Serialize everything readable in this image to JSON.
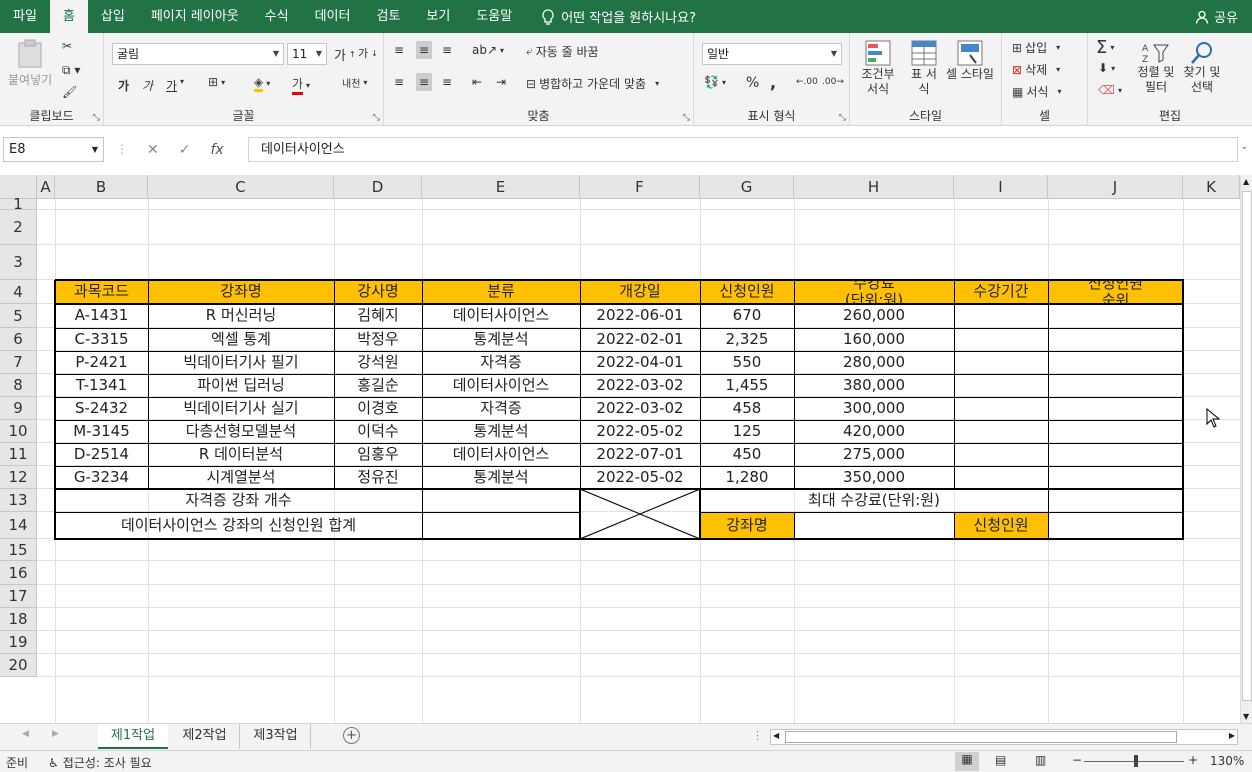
{
  "menu": {
    "tabs": [
      "파일",
      "홈",
      "삽입",
      "페이지 레이아웃",
      "수식",
      "데이터",
      "검토",
      "보기",
      "도움말"
    ],
    "active": "홈",
    "tell_me": "어떤 작업을 원하시나요?",
    "share": "공유"
  },
  "ribbon": {
    "clipboard": {
      "paste": "붙여넣기",
      "label": "클립보드"
    },
    "font": {
      "name": "굴림",
      "size": "11",
      "label": "글꼴",
      "bold": "가",
      "italic": "가",
      "underline": "가"
    },
    "alignment": {
      "wrap": "자동 줄 바꿈",
      "merge": "병합하고 가운데 맞춤",
      "label": "맞춤"
    },
    "number": {
      "format": "일반",
      "label": "표시 형식",
      "percent": "%",
      "comma": ","
    },
    "styles": {
      "conditional": "조건부 서식",
      "table": "표 서식",
      "cell": "셀 스타일",
      "label": "스타일"
    },
    "cells": {
      "insert": "삽입",
      "delete": "삭제",
      "format": "서식",
      "label": "셀"
    },
    "editing": {
      "sort": "정렬 및 필터",
      "find": "찾기 및 선택",
      "label": "편집"
    }
  },
  "formula_bar": {
    "name_box": "E8",
    "fx": "fx",
    "content": "데이터사이언스"
  },
  "grid": {
    "columns": [
      "A",
      "B",
      "C",
      "D",
      "E",
      "F",
      "G",
      "H",
      "I",
      "J",
      "K"
    ],
    "rows": [
      "1",
      "2",
      "3",
      "4",
      "5",
      "6",
      "7",
      "8",
      "9",
      "10",
      "11",
      "12",
      "13",
      "14",
      "15",
      "16",
      "17",
      "18",
      "19",
      "20"
    ],
    "headers": [
      "과목코드",
      "강좌명",
      "강사명",
      "분류",
      "개강일",
      "신청인원",
      "수강료\n(단위:원)",
      "수강기간",
      "신청인원\n순위"
    ],
    "data": [
      [
        "A-1431",
        "R 머신러닝",
        "김혜지",
        "데이터사이언스",
        "2022-06-01",
        "670",
        "260,000"
      ],
      [
        "C-3315",
        "엑셀 통계",
        "박정우",
        "통계분석",
        "2022-02-01",
        "2,325",
        "160,000"
      ],
      [
        "P-2421",
        "빅데이터기사 필기",
        "강석원",
        "자격증",
        "2022-04-01",
        "550",
        "280,000"
      ],
      [
        "T-1341",
        "파이썬 딥러닝",
        "홍길순",
        "데이터사이언스",
        "2022-03-02",
        "1,455",
        "380,000"
      ],
      [
        "S-2432",
        "빅데이터기사 실기",
        "이경호",
        "자격증",
        "2022-03-02",
        "458",
        "300,000"
      ],
      [
        "M-3145",
        "다층선형모델분석",
        "이덕수",
        "통계분석",
        "2022-05-02",
        "125",
        "420,000"
      ],
      [
        "D-2514",
        "R 데이터분석",
        "임홍우",
        "데이터사이언스",
        "2022-07-01",
        "450",
        "275,000"
      ],
      [
        "G-3234",
        "시계열분석",
        "정유진",
        "통계분석",
        "2022-05-02",
        "1,280",
        "350,000"
      ]
    ],
    "summary": {
      "cert_count": "자격증 강좌 개수",
      "ds_sum": "데이터사이언스 강좌의 신청인원 합계",
      "max_fee": "최대 수강료(단위:원)",
      "course_name": "강좌명",
      "applicants": "신청인원"
    }
  },
  "sheets": {
    "tabs": [
      "제1작업",
      "제2작업",
      "제3작업"
    ],
    "active": "제1작업"
  },
  "status": {
    "ready": "준비",
    "accessibility": "접근성: 조사 필요",
    "zoom": "130%"
  },
  "colors": {
    "brand": "#217346",
    "header_fill": "#ffc000"
  }
}
